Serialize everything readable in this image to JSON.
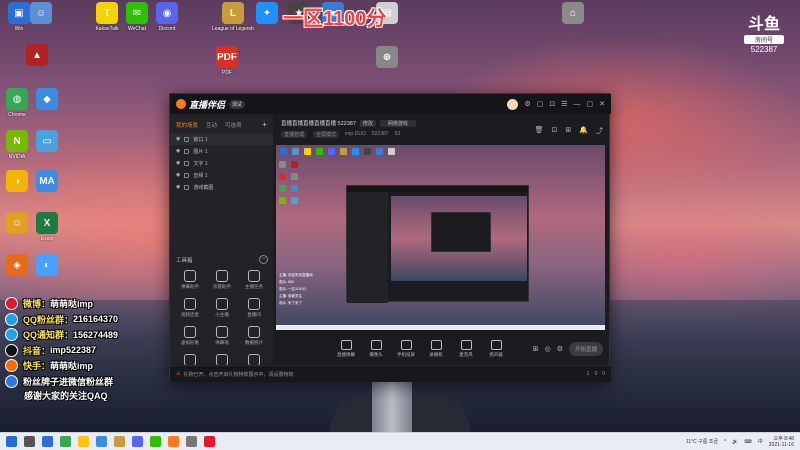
{
  "banner": "一区1100分",
  "douyu_badge": {
    "logo": "斗鱼",
    "room_label": "房间号",
    "room_no": "522387"
  },
  "desktop_icons": [
    {
      "label": "Win",
      "glyph": "▣",
      "color": "#2b6fd6"
    },
    {
      "label": "",
      "glyph": "☺",
      "color": "#5b8fd6"
    },
    {
      "label": "KakaoTalk",
      "glyph": "T",
      "color": "#f5d200"
    },
    {
      "label": "WeChat",
      "glyph": "✉",
      "color": "#2dc100"
    },
    {
      "label": "Discord",
      "glyph": "◉",
      "color": "#5865f2"
    },
    {
      "label": "League of Legends",
      "glyph": "L",
      "color": "#c89b3c"
    },
    {
      "label": "",
      "glyph": "✦",
      "color": "#1e90ff"
    },
    {
      "label": "",
      "glyph": "★",
      "color": "#444444"
    },
    {
      "label": "",
      "glyph": "●",
      "color": "#3b7bd8"
    },
    {
      "label": "",
      "glyph": "▤",
      "color": "#cfcfcf"
    },
    {
      "label": "",
      "glyph": "⌂",
      "color": "#8a8a8a"
    },
    {
      "label": "",
      "glyph": "▲",
      "color": "#b32222"
    },
    {
      "label": "PDF",
      "glyph": "PDF",
      "color": "#d93025"
    },
    {
      "label": "",
      "glyph": "⊕",
      "color": "#888888"
    },
    {
      "label": "Chrome",
      "glyph": "◍",
      "color": "#34a853"
    },
    {
      "label": "",
      "glyph": "◆",
      "color": "#3a8de0"
    },
    {
      "label": "NVIDIA",
      "glyph": "N",
      "color": "#76b900"
    },
    {
      "label": "",
      "glyph": "▭",
      "color": "#4aa3df"
    },
    {
      "label": "",
      "glyph": "◑",
      "color": "#f4b400"
    },
    {
      "label": "",
      "glyph": "MA",
      "color": "#3a8de0"
    },
    {
      "label": "",
      "glyph": "☺",
      "color": "#e0a020"
    },
    {
      "label": "Excel",
      "glyph": "X",
      "color": "#1d7a43"
    },
    {
      "label": "",
      "glyph": "◈",
      "color": "#e86a1c"
    },
    {
      "label": "",
      "glyph": "◐",
      "color": "#48a0ff"
    }
  ],
  "app": {
    "logo": "直播伴侣",
    "version": "测试",
    "window_controls": [
      "⚙",
      "▢",
      "⊡",
      "☰",
      "—",
      "▢",
      "✕"
    ],
    "sidebar": {
      "tabs": [
        "我的场景",
        "互动",
        "可选项"
      ],
      "add": "+",
      "scenes": [
        {
          "label": "窗口 1",
          "selected": true
        },
        {
          "label": "图片 1",
          "selected": false
        },
        {
          "label": "文字 1",
          "selected": false
        },
        {
          "label": "音频 1",
          "selected": false
        },
        {
          "label": "游戏截图",
          "selected": false
        }
      ],
      "tools_title": "工具箱",
      "tools_min": "−",
      "tools": [
        "弹幕助手",
        "房管助手",
        "主播任务",
        "视频连麦",
        "小主播",
        "直播间",
        "虚拟形象",
        "弹幕墙",
        "数据统计",
        "",
        "",
        ""
      ]
    },
    "stream": {
      "title": "直播直播直播直播直播 522387",
      "tag": "修改",
      "category": "网络游戏",
      "sub": [
        "直播管理",
        "全屏模式",
        "imp·DUO",
        "522387",
        "63"
      ],
      "header_icons": [
        "🗑",
        "⊡",
        "⊞",
        "🔔",
        "⤴"
      ]
    },
    "preview_chat": [
      "主播: 欢迎来到直播间",
      "观众: 666",
      "观众: 一区1100分",
      "主播: 谢谢关注",
      "观众: 来了来了"
    ],
    "toolbar": {
      "buttons": [
        "直播弹幕",
        "摄像头",
        "手机投屏",
        "录播机",
        "麦克风",
        "扬声器"
      ],
      "right_icons": [
        "⊞",
        "◎",
        "⚙"
      ],
      "go_live": "开始直播"
    },
    "status": {
      "warning_icon": "⚠",
      "text": "礼物已开，点击开启礼物特效展示中，请设置特效",
      "right": [
        "1",
        "0",
        "0"
      ]
    }
  },
  "overlay": {
    "lines": [
      {
        "k": "微博：",
        "v": "萌萌哒imp",
        "color": "#e6162d"
      },
      {
        "k": "QQ粉丝群：",
        "v": "216164370",
        "color": "#1da1f2"
      },
      {
        "k": "QQ通知群：",
        "v": "156274489",
        "color": "#1da1f2"
      },
      {
        "k": "抖音：",
        "v": "imp522387",
        "color": "#111111"
      },
      {
        "k": "快手：",
        "v": "萌萌哒imp",
        "color": "#ff6a00"
      },
      {
        "k": "",
        "v": "粉丝牌子进微信粉丝群",
        "color": "#2a7ae2"
      }
    ],
    "thanks": "感谢大家的关注QAQ"
  },
  "taskbar": {
    "app_colors": [
      "#1e6fd8",
      "#555555",
      "#2b6fd6",
      "#34a853",
      "#ffc20e",
      "#3a8de0",
      "#c89b3c",
      "#5865f2",
      "#2dc100",
      "#ff7a1a",
      "#777777",
      "#e6162d"
    ],
    "weather": "11°C 구름 조금",
    "tray_icons": [
      "^",
      "🔊",
      "⌨",
      "中"
    ],
    "time": "오후 8:48",
    "date": "2021-11-16"
  }
}
